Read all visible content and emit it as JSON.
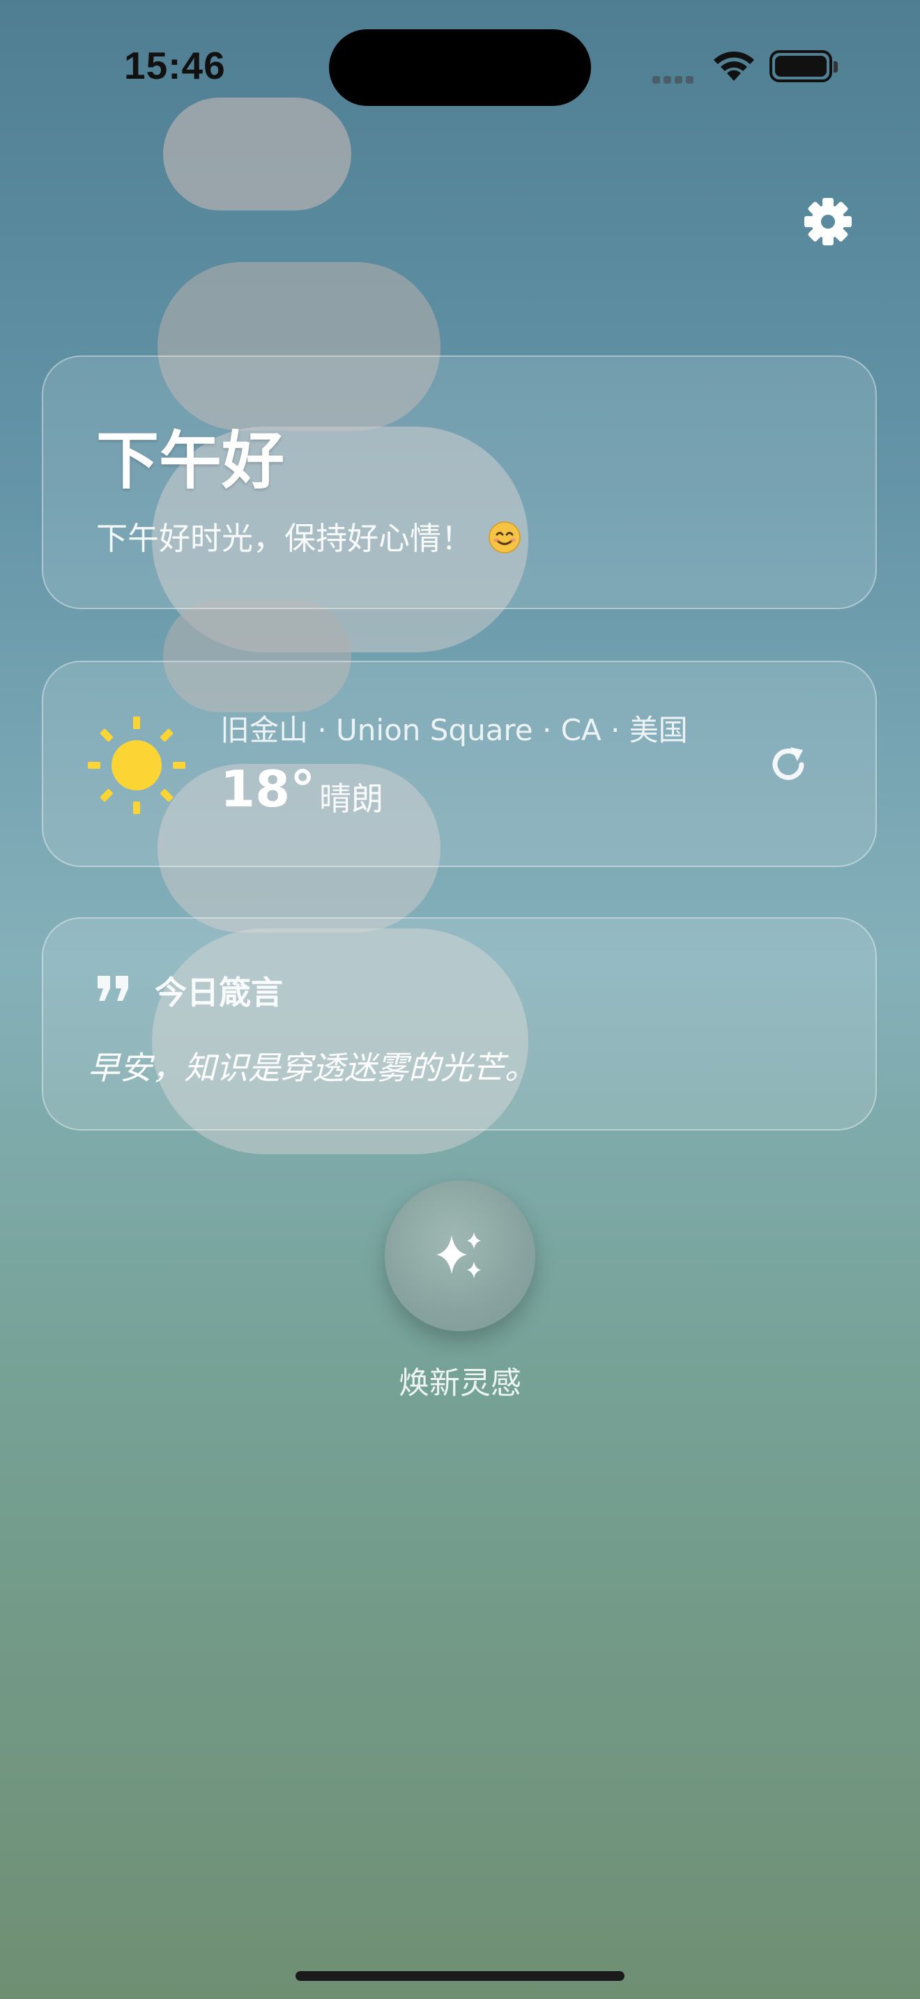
{
  "status_bar": {
    "time": "15:46"
  },
  "greeting": {
    "title": "下午好",
    "subtitle": "下午好时光，保持好心情！",
    "emoji": "😊"
  },
  "weather": {
    "location": "旧金山 · Union Square · CA · 美国",
    "temperature": "18°",
    "condition": "晴朗",
    "icon": "sun-icon"
  },
  "quote": {
    "title": "今日箴言",
    "text": "早安，知识是穿透迷雾的光芒。"
  },
  "action": {
    "label": "焕新灵感",
    "icon": "sparkles-icon"
  },
  "colors": {
    "sun": "#fcd535",
    "background_top": "#4f7e93",
    "background_bottom": "#6f8f73"
  }
}
